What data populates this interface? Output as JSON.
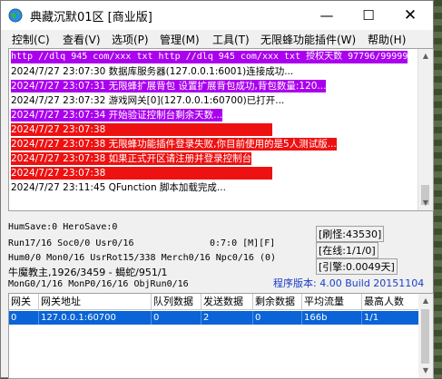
{
  "window": {
    "title": "典藏沉默01区 [商业版]",
    "controls": {
      "minimize": "—",
      "maximize": "☐",
      "close": "✕"
    }
  },
  "menu": [
    "控制(C)",
    "查看(V)",
    "选项(P)",
    "管理(M)",
    "工具(T)",
    "无限蜂功能插件(W)",
    "帮助(H)"
  ],
  "log": [
    {
      "text": "http //dlq 945 com/xxx txt http //dlq 945 com/xxx txt 授权天数 97796/99999",
      "style": "purple"
    },
    {
      "text": "2024/7/27 23:07:30 数据库服务器(127.0.0.1:6001)连接成功...",
      "style": "plain"
    },
    {
      "text": "2024/7/27 23:07:31 无限蜂扩展背包 设置扩展背包成功,背包数量:120...",
      "style": "purple"
    },
    {
      "text": "2024/7/27 23:07:32 游戏网关[0](127.0.0.1:60700)已打开...",
      "style": "plain"
    },
    {
      "text": "2024/7/27 23:07:34 开始验证控制台剩余天数...",
      "style": "purple"
    },
    {
      "text": "2024/7/27 23:07:38",
      "style": "red"
    },
    {
      "text": "2024/7/27 23:07:38 无限蜂功能插件登录失败,你目前使用的是5人测试版...",
      "style": "red"
    },
    {
      "text": "2024/7/27 23:07:38 如果正式开区请注册并登录控制台",
      "style": "red"
    },
    {
      "text": "2024/7/27 23:07:38",
      "style": "red"
    },
    {
      "text": "2024/7/27 23:11:45 QFunction 脚本加载完成...",
      "style": "plain"
    }
  ],
  "stats": {
    "line1": "HumSave:0 HeroSave:0",
    "line2": "Run17/16 Soc0/0 Usr0/16",
    "line2b": "0:7:0 [M][F]",
    "line3": "Hum0/0 Mon0/16 UsrRot15/338 Merch0/16 Npc0/16 (0)",
    "line4": "牛魔教主,1926/3459 - 蝎蛇/951/1",
    "line5": "MonG0/1/16 MonP0/16/16 ObjRun0/16",
    "refresh": "[刷怪:43530]",
    "online": "[在线:1/1/0]",
    "ref": "[引擎:0.0049天]",
    "version": "程序版本: 4.00 Build 20151104"
  },
  "table": {
    "headers": [
      "网关",
      "网关地址",
      "队列数据",
      "发送数据",
      "剩余数据",
      "平均流量",
      "最高人数"
    ],
    "rows": [
      [
        "0",
        "127.0.0.1:60700",
        "0",
        "2",
        "0",
        "166b",
        "1/1"
      ]
    ]
  }
}
